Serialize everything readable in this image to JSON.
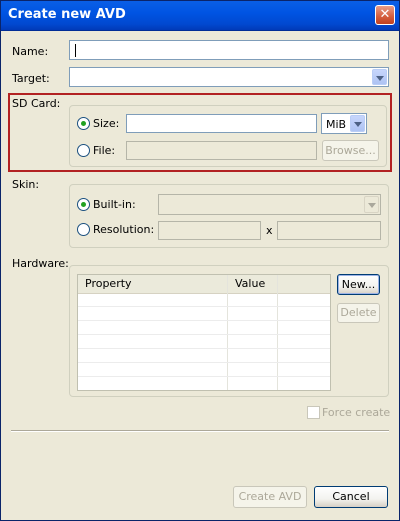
{
  "window": {
    "title": "Create new AVD",
    "close_glyph": "✕"
  },
  "form": {
    "name_label": "Name:",
    "name_value": "",
    "target_label": "Target:",
    "target_value": "",
    "sdcard_label": "SD Card:",
    "size_label": "Size:",
    "size_value": "",
    "size_unit": "MiB",
    "file_label": "File:",
    "file_value": "",
    "browse_label": "Browse...",
    "skin_label": "Skin:",
    "builtin_label": "Built-in:",
    "builtin_value": "",
    "resolution_label": "Resolution:",
    "resolution_x_sep": "x",
    "hardware_label": "Hardware:",
    "new_label": "New...",
    "delete_label": "Delete",
    "force_create_label": "Force create"
  },
  "hardware_table": {
    "columns": [
      "Property",
      "Value"
    ],
    "rows": []
  },
  "footer": {
    "create_label": "Create AVD",
    "cancel_label": "Cancel"
  },
  "state": {
    "sd_card_mode": "size",
    "skin_mode": "built-in",
    "force_create_checked": false,
    "sd_card_section_highlighted": true
  },
  "colors": {
    "titlebar": "#0054e3",
    "highlight_border": "#b22222",
    "radio_selected": "#21a121"
  }
}
